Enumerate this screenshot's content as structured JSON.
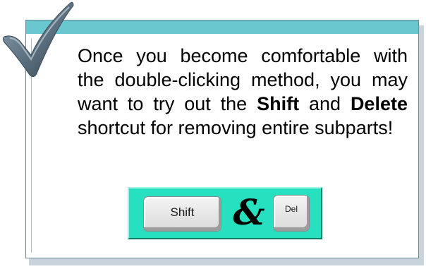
{
  "tip": {
    "line_1": "Once you become comfortable with the double-clicking method, you may want to try out the ",
    "key_word_shift": "Shift",
    "line_and": " and ",
    "key_word_delete": "Delete",
    "line_2": " shortcut for removing entire subparts!"
  },
  "keys": {
    "shift_label": "Shift",
    "connector": "&",
    "del_label": "Del"
  },
  "colors": {
    "accent_bar": "#68c7cf",
    "keys_panel": "#27e0bf",
    "checkmark": "#5a6f7e"
  },
  "icons": {
    "check": "checkmark-icon"
  }
}
